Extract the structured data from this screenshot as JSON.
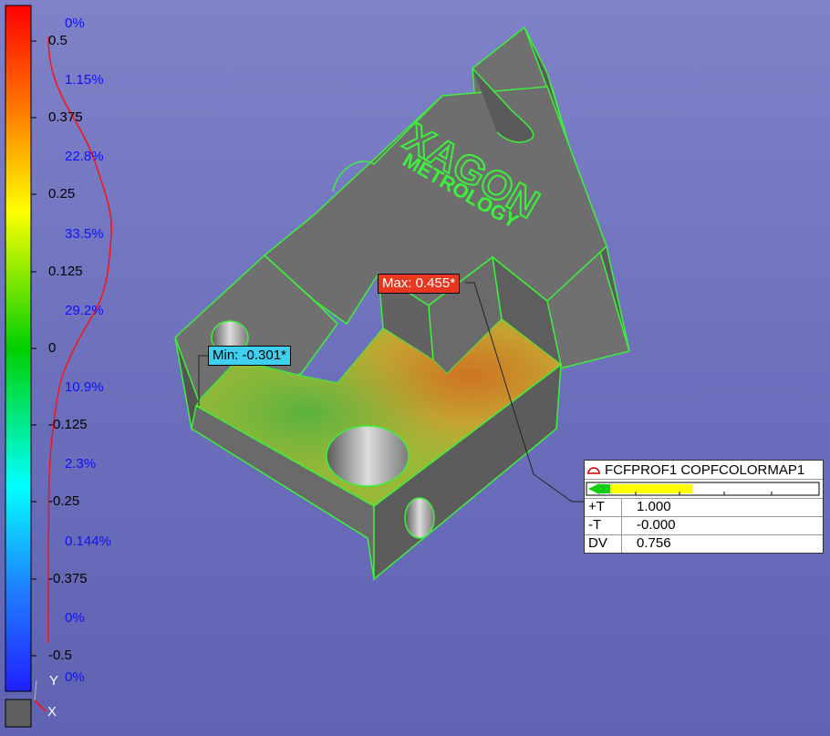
{
  "legend": {
    "scale_labels": [
      "0.5",
      "0.375",
      "0.25",
      "0.125",
      "0",
      "-0.125",
      "-0.25",
      "-0.375",
      "-0.5"
    ],
    "percent_labels": [
      "0%",
      "1.15%",
      "22.8%",
      "33.5%",
      "29.2%",
      "10.9%",
      "2.3%",
      "0.144%",
      "0%",
      "0%"
    ]
  },
  "part": {
    "logo_line1": "XAGON",
    "logo_line2": "METROLOGY"
  },
  "callouts": {
    "min": "Min: -0.301*",
    "max": "Max: 0.455*"
  },
  "fcf_box": {
    "title": "FCFPROF1 COPFCOLORMAP1",
    "rows": [
      {
        "key": "+T",
        "value": "1.000"
      },
      {
        "key": "-T",
        "value": "-0.000"
      },
      {
        "key": "DV",
        "value": "0.756"
      }
    ]
  },
  "axes": {
    "y": "Y",
    "x": "X"
  },
  "colors": {
    "edge": "#3cf03c",
    "part": "#6b6b6b",
    "background": "#7378c0"
  }
}
